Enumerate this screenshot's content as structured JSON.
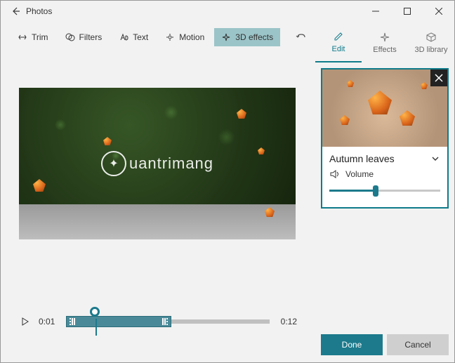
{
  "window": {
    "title": "Photos"
  },
  "toolbar": {
    "trim": "Trim",
    "filters": "Filters",
    "text": "Text",
    "motion": "Motion",
    "effects3d": "3D effects"
  },
  "timeline": {
    "current": "0:01",
    "duration": "0:12"
  },
  "panel": {
    "tabs": {
      "edit": "Edit",
      "effects": "Effects",
      "library": "3D library"
    },
    "effect": {
      "name": "Autumn leaves",
      "volume_label": "Volume",
      "volume_pct": 42
    },
    "actions": {
      "done": "Done",
      "cancel": "Cancel"
    }
  },
  "watermark": "uantrimang"
}
